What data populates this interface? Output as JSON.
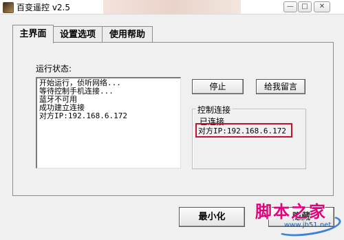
{
  "window": {
    "title": "百变遥控 v2.5",
    "controls": {
      "minimize": "—",
      "maximize": "□",
      "close": "✕"
    }
  },
  "tabs": [
    {
      "label": "主界面",
      "active": true
    },
    {
      "label": "设置选项",
      "active": false
    },
    {
      "label": "使用帮助",
      "active": false
    }
  ],
  "main": {
    "status_label": "运行状态:",
    "status_lines": [
      "开始运行，侦听网络...",
      "等待控制手机连接...",
      "蓝牙不可用",
      "成功建立连接",
      "对方IP:192.168.6.172"
    ],
    "stop_button": "停止",
    "message_button": "给我留言",
    "group": {
      "title": "控制连接",
      "connected_label": "已连接",
      "peer_ip": "对方IP:192.168.6.172"
    },
    "minimize_button": "最小化",
    "hidden_button": "隐藏"
  },
  "watermark": {
    "main": "脚本之家",
    "url": "www.jb51.net"
  },
  "colors": {
    "highlight": "#c8102e",
    "watermark_main": "#e6007e",
    "watermark_url": "#1a5aa6"
  }
}
